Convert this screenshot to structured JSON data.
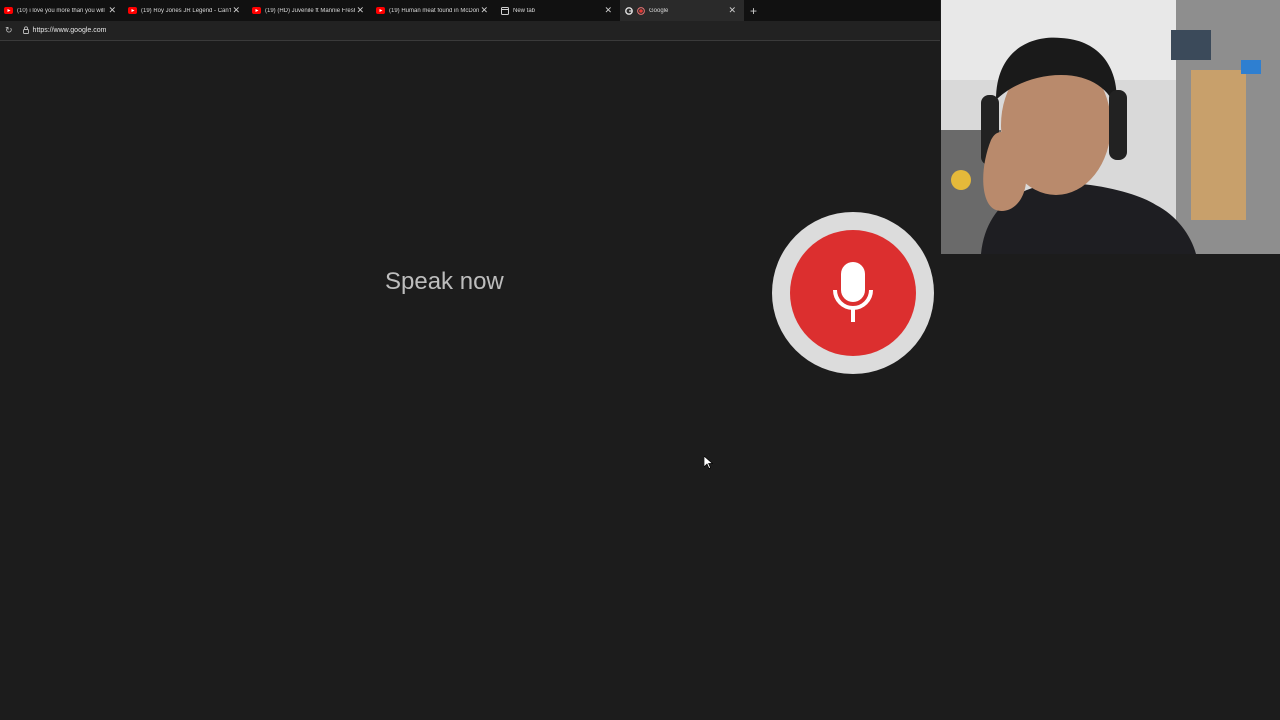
{
  "browser": {
    "tabs": [
      {
        "title": "(10) i love you more than you will",
        "icon": "youtube-icon",
        "active": false
      },
      {
        "title": "(19) Roy Jones JR Legend - Can't",
        "icon": "youtube-icon",
        "active": false
      },
      {
        "title": "(19) (HD) Juvenile ft Mannie Fresh",
        "icon": "youtube-icon",
        "active": false
      },
      {
        "title": "(19) Human meat found in McDon",
        "icon": "youtube-icon",
        "active": false
      },
      {
        "title": "New tab",
        "icon": "new-tab-icon",
        "active": false
      },
      {
        "title": "Google",
        "icon": "google-icon",
        "active": true
      }
    ],
    "close_glyph": "✕",
    "new_tab_glyph": "+",
    "reload_glyph": "↻",
    "url": "https://www.google.com"
  },
  "voice_search": {
    "prompt": "Speak now",
    "mic_color": "#dc2f2f"
  }
}
